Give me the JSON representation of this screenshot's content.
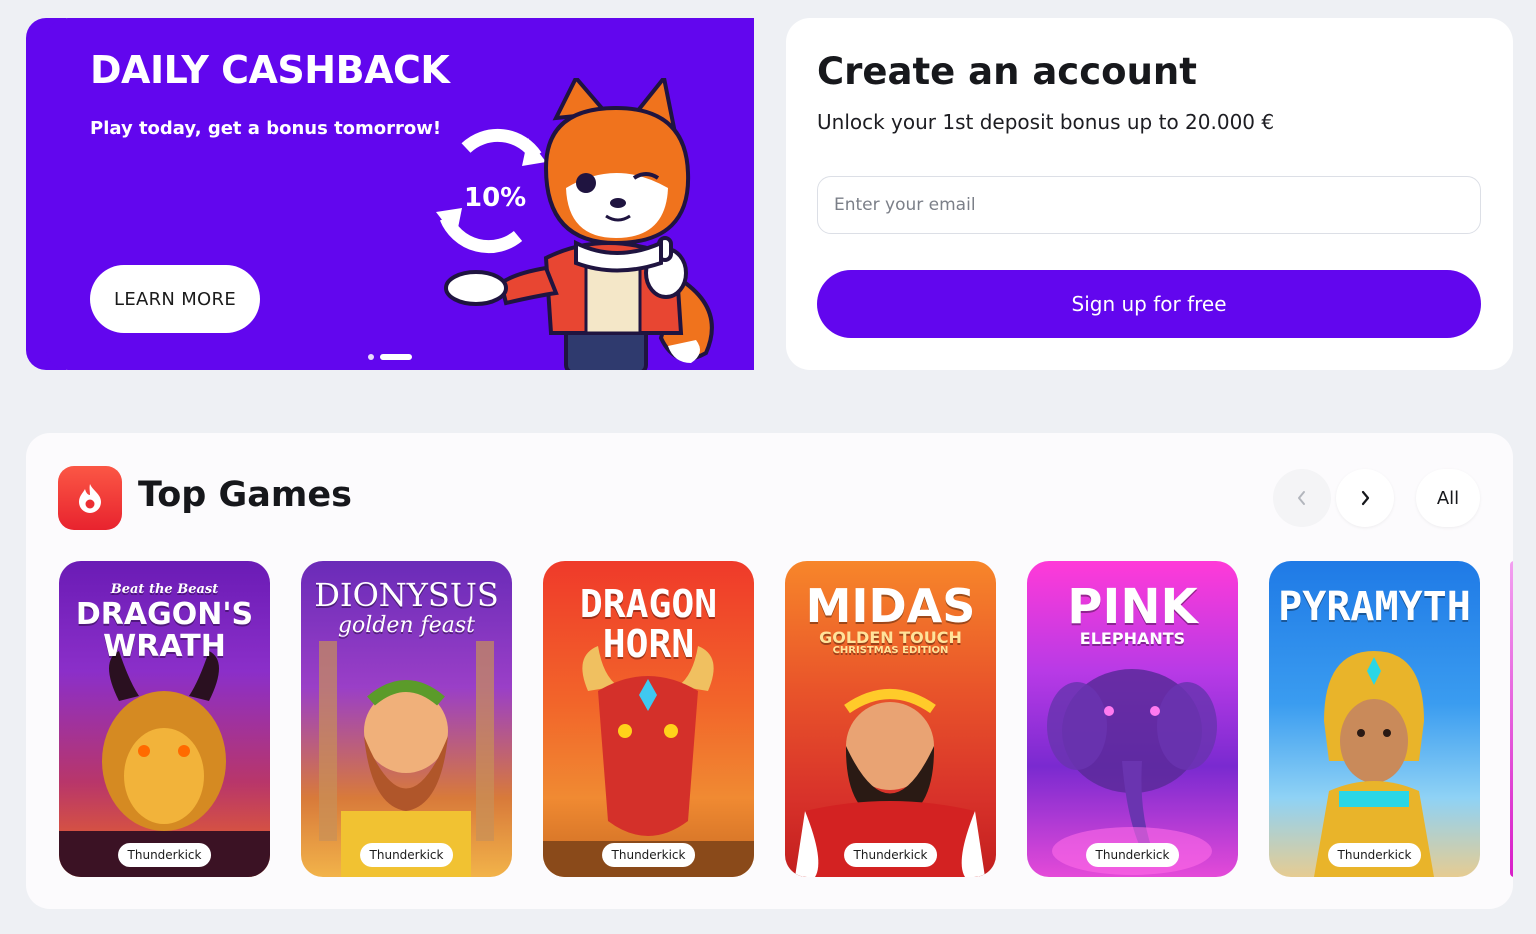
{
  "promo": {
    "title": "DAILY CASHBACK",
    "subtitle": "Play today, get a bonus tomorrow!",
    "badge": "10%",
    "cta_label": "LEARN MORE",
    "slide_count": 2,
    "active_slide": 2,
    "color": "#6206ee"
  },
  "signup": {
    "title": "Create an account",
    "subtitle": "Unlock your 1st deposit bonus up to 20.000 €",
    "email_placeholder": "Enter your email",
    "email_value": "",
    "submit_label": "Sign up for free",
    "color": "#6206ee"
  },
  "top_games": {
    "icon": "fire-icon",
    "title": "Top Games",
    "prev_icon": "chevron-left-icon",
    "next_icon": "chevron-right-icon",
    "all_label": "All",
    "games": [
      {
        "tagline": "Beat the Beast",
        "title": "DRAGON'S WRATH",
        "provider": "Thunderkick"
      },
      {
        "title": "DIONYSUS",
        "tagline": "golden feast",
        "provider": "Thunderkick"
      },
      {
        "title": "DRAGON HORN",
        "provider": "Thunderkick"
      },
      {
        "title": "MIDAS",
        "tagline": "GOLDEN TOUCH",
        "edition": "CHRISTMAS EDITION",
        "provider": "Thunderkick"
      },
      {
        "title": "PINK",
        "tagline": "ELEPHANTS",
        "provider": "Thunderkick"
      },
      {
        "title": "PYRAMYTH",
        "provider": "Thunderkick"
      }
    ]
  }
}
